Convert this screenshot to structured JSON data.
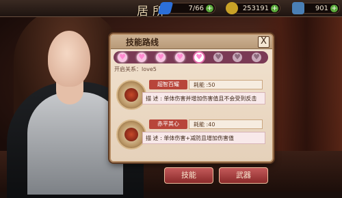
{
  "top_bar": {
    "title": "居所",
    "resources": [
      {
        "icon": "energy-icon",
        "value": "7/66"
      },
      {
        "icon": "gold-coin-icon",
        "value": "253191"
      },
      {
        "icon": "gem-icon",
        "value": "901"
      }
    ],
    "add_symbol": "+"
  },
  "skill_panel": {
    "title": "技能路线",
    "close_label": "X",
    "hearts": [
      "♥",
      "♥",
      "♥",
      "♥",
      "♥",
      "♥",
      "♥",
      "♥"
    ],
    "unlock_relation": "开启关系：love5",
    "skills": [
      {
        "name": "超智百耀",
        "energy": "耗能 :50",
        "description": "描 述 : 单体伤害并增加伤害值且不会受到反击"
      },
      {
        "name": "赤平其心",
        "energy": "耗能 :40",
        "description": "描 述 : 单体伤害+减防且增加伤害值"
      }
    ]
  },
  "buttons": {
    "skill": "技能",
    "weapon": "武器"
  }
}
